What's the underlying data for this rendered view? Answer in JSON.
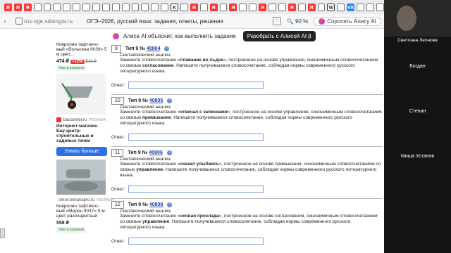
{
  "browser": {
    "tab_icons": [
      {
        "glyph": "Я",
        "color": "#f33"
      },
      {
        "glyph": "Я",
        "color": "#f33"
      },
      {
        "glyph": "Я",
        "color": "#f33"
      },
      {
        "glyph": "",
        "color": "#777"
      },
      {
        "glyph": "",
        "color": "#777"
      },
      {
        "glyph": "",
        "color": "#777"
      },
      {
        "glyph": "",
        "color": "#777"
      },
      {
        "glyph": "",
        "color": "#777"
      },
      {
        "glyph": "",
        "color": "#777"
      },
      {
        "glyph": "",
        "color": "#777"
      },
      {
        "glyph": "",
        "color": "#777"
      },
      {
        "glyph": "",
        "color": "#777"
      },
      {
        "glyph": "",
        "color": "#777"
      },
      {
        "glyph": "",
        "color": "#777"
      },
      {
        "glyph": "",
        "color": "#777"
      },
      {
        "glyph": "",
        "color": "#777"
      },
      {
        "glyph": "",
        "color": "#777"
      },
      {
        "glyph": "K",
        "color": "#333"
      },
      {
        "glyph": "",
        "color": "#777"
      },
      {
        "glyph": "Я",
        "color": "#f33"
      },
      {
        "glyph": "",
        "color": "#777"
      },
      {
        "glyph": "Я",
        "color": "#f33"
      },
      {
        "glyph": "",
        "color": "#777"
      },
      {
        "glyph": "Я",
        "color": "#f33"
      },
      {
        "glyph": "",
        "color": "#777"
      },
      {
        "glyph": "",
        "color": "#777"
      },
      {
        "glyph": "Я",
        "color": "#f33"
      },
      {
        "glyph": "",
        "color": "#777"
      },
      {
        "glyph": "",
        "color": "#777"
      },
      {
        "glyph": "Я",
        "color": "#f33"
      },
      {
        "glyph": "",
        "color": "#777"
      },
      {
        "glyph": "Я",
        "color": "#f33"
      },
      {
        "glyph": "",
        "color": "#777"
      },
      {
        "glyph": "W",
        "color": "#333"
      },
      {
        "glyph": "",
        "color": "#777"
      },
      {
        "glyph": "VK",
        "color": "#2787f5"
      },
      {
        "glyph": "",
        "color": "#777"
      },
      {
        "glyph": "",
        "color": "#777"
      },
      {
        "glyph": "",
        "color": "#777"
      }
    ],
    "url": "rus-oge.sdamgia.ru",
    "title": "ОГЭ−2026, русский язык: задания, ответы, решения",
    "zoom": "90 %",
    "ask_button": "Спросить Алису AI"
  },
  "ai_bar": {
    "text": "Алиса AI объяснит, как выполнить задание",
    "button": "Разобрать с Алисой AI β"
  },
  "ads": {
    "ad1": {
      "title": "Ковролин тафтинго-вый «Вольсена 9039» 5 м цвет...",
      "price": "474 ₽",
      "discount": "−12%",
      "old_price": "541 ₽",
      "badge": "Уже в корзине"
    },
    "ad2": {
      "source": "baucenter.ru",
      "source_tag": "РЕКЛАМА",
      "title": "Интернет-магазин Бау-центр: строительные и садовые тачки",
      "button": "Узнать больше"
    },
    "ad3": {
      "source": "omsk.lemanapro.ru",
      "source_tag": "РЕКЛАМА",
      "title": "Ковролин тафтинго-вый «Мерен 9037» 5 м цвет разноцветный",
      "price": "558 ₽",
      "badge": "Уже в корзине"
    }
  },
  "tasks": [
    {
      "num": "9",
      "type_label": "Тип 9 №",
      "id": "40804",
      "sub": "Синтаксический анализ.",
      "desc_pre": "Замените словосочетание «",
      "phrase": "плавание во льдах",
      "desc_mid": "», построенное на основе управления, синонимичным словосочетанием со связью ",
      "link_type": "согласование",
      "desc_post": ". Напишите получившееся словосочетание, соблюдая нормы современного русского литературного языка.",
      "answer_label": "Ответ:"
    },
    {
      "num": "10",
      "type_label": "Тип 9 №",
      "id": "40805",
      "sub": "Синтаксический анализ.",
      "desc_pre": "Замените словосочетание «",
      "phrase": "отвечал с запинками",
      "desc_mid": "», построенное на основе управления, синонимичным словосочетанием со связью ",
      "link_type": "примыкание",
      "desc_post": ". Напишите получившееся словосочетание, соблюдая нормы современного русского литературного языка.",
      "answer_label": "Ответ:"
    },
    {
      "num": "11",
      "type_label": "Тип 9 №",
      "id": "40806",
      "sub": "Синтаксический анализ.",
      "desc_pre": "Замените словосочетание «",
      "phrase": "сказал улыбаясь",
      "desc_mid": "», построенное на основе примыкания, синонимичным словосочетанием со связью ",
      "link_type": "управление",
      "desc_post": ". Напишите получившееся словосочетание, соблюдая нормы современного русского литературного языка.",
      "answer_label": "Ответ:"
    },
    {
      "num": "12",
      "type_label": "Тип 9 №",
      "id": "40808",
      "sub": "Синтаксический анализ.",
      "desc_pre": "Замените словосочетание «",
      "phrase": "ночная прохлада",
      "desc_mid": "», построенное на основе согласования, синонимичным словосочетанием со связью ",
      "link_type": "управление",
      "desc_post": ". Напишите получившееся словосочетание, соблюдая нормы современного русского литературного языка.",
      "answer_label": "Ответ:"
    }
  ],
  "participants": [
    "Светлана Леонова",
    "Богдан",
    "Степан",
    "Миша Установ"
  ],
  "colors": {
    "link": "#1a3fa8",
    "accent": "#2f6fe4",
    "video_bg": "#121416"
  }
}
